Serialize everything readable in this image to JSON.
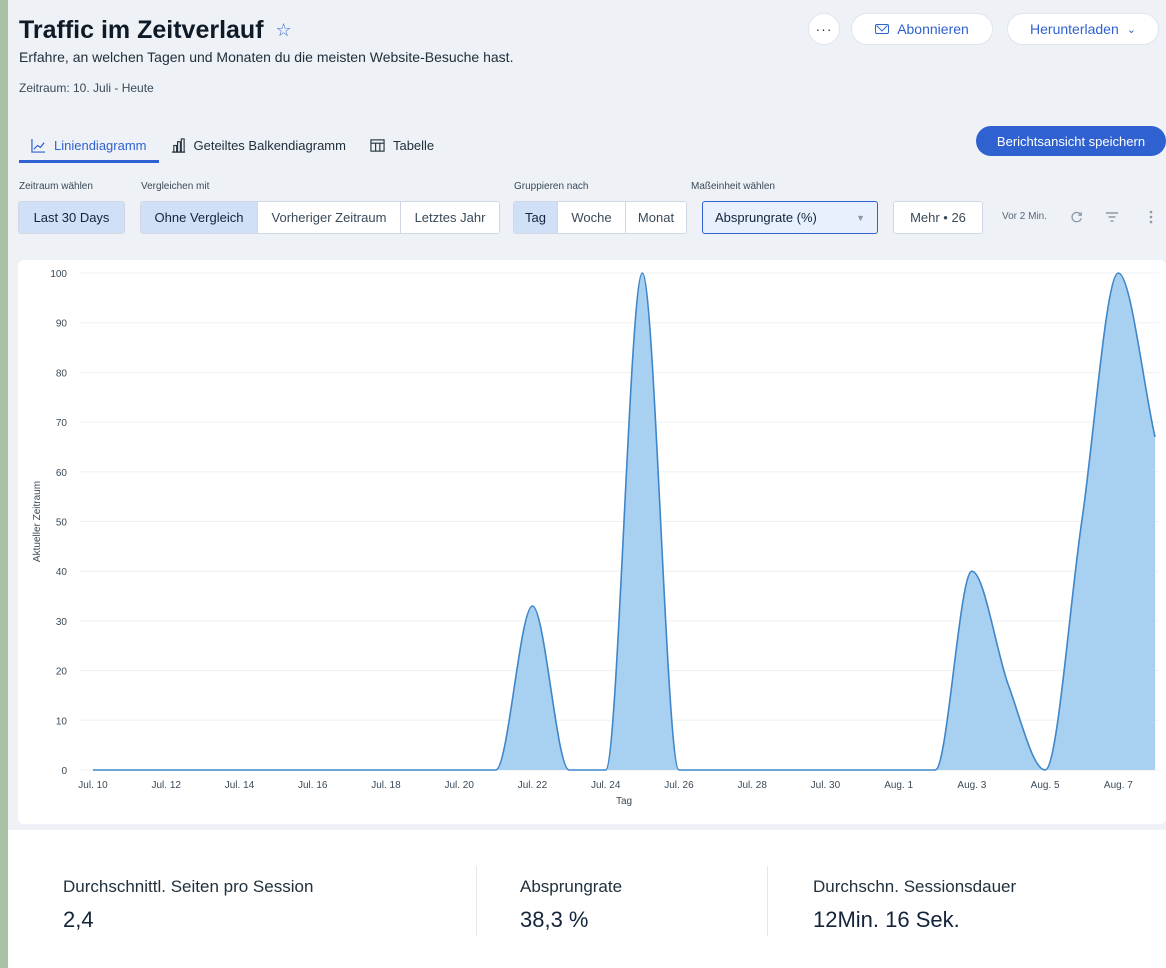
{
  "header": {
    "title": "Traffic im Zeitverlauf",
    "subtitle": "Erfahre, an welchen Tagen und Monaten du die meisten Website-Besuche hast.",
    "period": "Zeitraum: 10. Juli - Heute",
    "more_label": "···",
    "subscribe_label": "Abonnieren",
    "download_label": "Herunterladen"
  },
  "tabs": [
    {
      "label": "Liniendiagramm",
      "active": true
    },
    {
      "label": "Geteiltes Balkendiagramm",
      "active": false
    },
    {
      "label": "Tabelle",
      "active": false
    }
  ],
  "save_view_label": "Berichtsansicht speichern",
  "filters": {
    "period_label": "Zeitraum wählen",
    "period_value": "Last 30 Days",
    "compare_label": "Vergleichen mit",
    "compare_options": [
      "Ohne Vergleich",
      "Vorheriger Zeitraum",
      "Letztes Jahr"
    ],
    "group_label": "Gruppieren nach",
    "group_options": [
      "Tag",
      "Woche",
      "Monat"
    ],
    "metric_label": "Maßeinheit wählen",
    "metric_value": "Absprungrate (%)",
    "more_label": "Mehr • 26",
    "updated": "Vor 2 Min."
  },
  "chart_data": {
    "type": "area",
    "xlabel": "Tag",
    "ylabel": "Aktueller Zeitraum",
    "ylim": [
      0,
      100
    ],
    "yticks": [
      0,
      10,
      20,
      30,
      40,
      50,
      60,
      70,
      80,
      90,
      100
    ],
    "x": [
      "Jul. 10",
      "Jul. 11",
      "Jul. 12",
      "Jul. 13",
      "Jul. 14",
      "Jul. 15",
      "Jul. 16",
      "Jul. 17",
      "Jul. 18",
      "Jul. 19",
      "Jul. 20",
      "Jul. 21",
      "Jul. 22",
      "Jul. 23",
      "Jul. 24",
      "Jul. 25",
      "Jul. 26",
      "Jul. 27",
      "Jul. 28",
      "Jul. 29",
      "Jul. 30",
      "Jul. 31",
      "Aug. 1",
      "Aug. 2",
      "Aug. 3",
      "Aug. 4",
      "Aug. 5",
      "Aug. 6",
      "Aug. 7",
      "Aug. 8"
    ],
    "xtick_labels": [
      "Jul. 10",
      "Jul. 12",
      "Jul. 14",
      "Jul. 16",
      "Jul. 18",
      "Jul. 20",
      "Jul. 22",
      "Jul. 24",
      "Jul. 26",
      "Jul. 28",
      "Jul. 30",
      "Aug. 1",
      "Aug. 3",
      "Aug. 5",
      "Aug. 7"
    ],
    "series": [
      {
        "values": [
          0,
          0,
          0,
          0,
          0,
          0,
          0,
          0,
          0,
          0,
          0,
          0,
          33,
          0,
          0,
          100,
          0,
          0,
          0,
          0,
          0,
          0,
          0,
          0,
          40,
          17,
          0,
          50,
          100,
          67
        ]
      }
    ],
    "grid": true,
    "colors": {
      "line": "#3f86c9",
      "fill": "#a8d0f1"
    }
  },
  "stats": [
    {
      "label": "Durchschnittl. Seiten pro Session",
      "value": "2,4"
    },
    {
      "label": "Absprungrate",
      "value": "38,3 %"
    },
    {
      "label": "Durchschn. Sessionsdauer",
      "value": "12Min. 16 Sek."
    }
  ]
}
